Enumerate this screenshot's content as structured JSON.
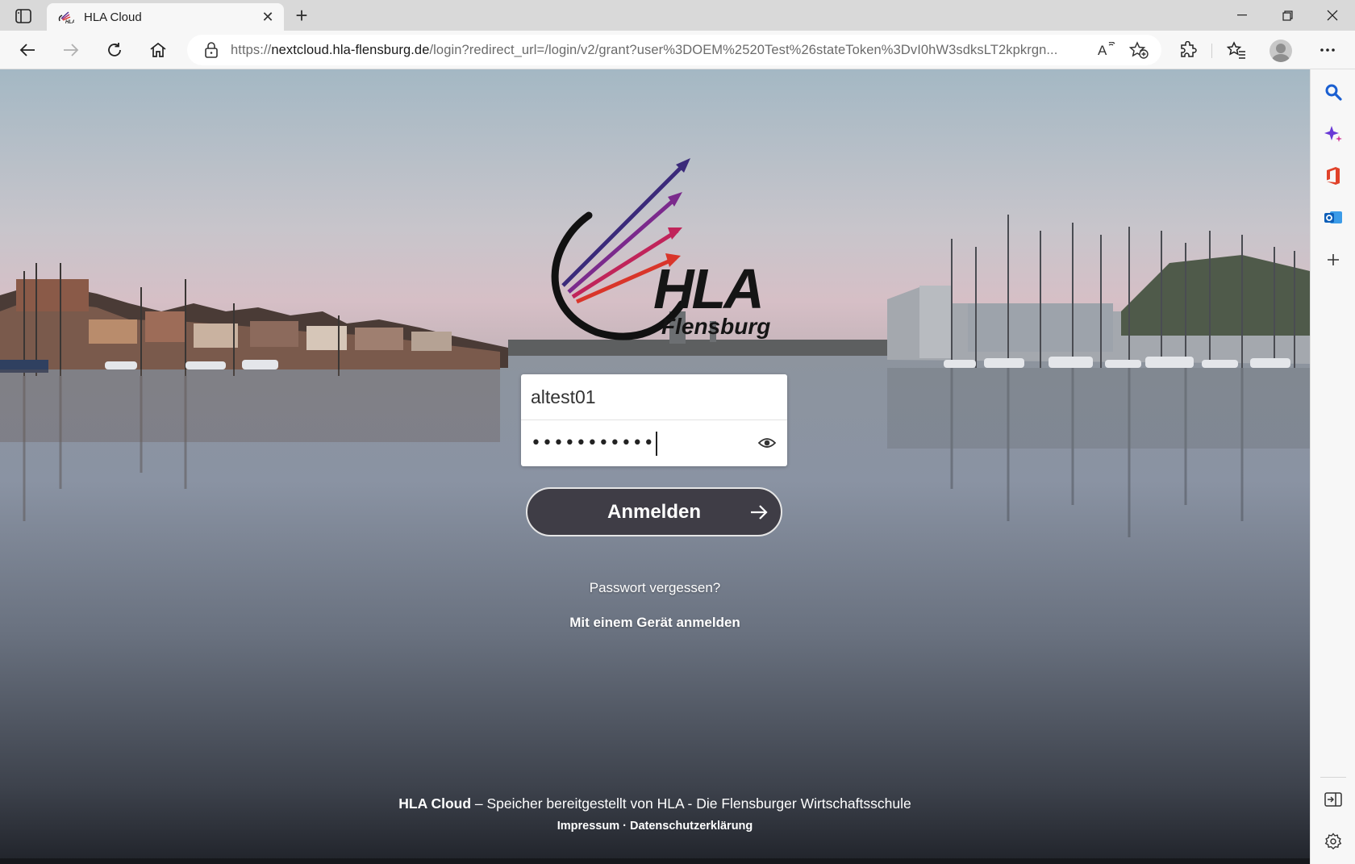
{
  "browser": {
    "tab": {
      "title": "HLA Cloud",
      "favicon": "hla-logo-icon"
    },
    "address": {
      "scheme": "https://",
      "host": "nextcloud.hla-flensburg.de",
      "path": "/login?redirect_url=/login/v2/grant?user%3DOEM%2520Test%26stateToken%3DvI0hW3sdksLT2kpkrgn..."
    },
    "icons": [
      "sidebar-toggle-icon",
      "back-icon",
      "forward-icon",
      "refresh-icon",
      "home-icon",
      "lock-icon",
      "read-aloud-icon",
      "add-favorite-icon",
      "extensions-icon",
      "favorites-icon",
      "profile-icon",
      "more-icon"
    ],
    "sidebar_icons": [
      "search-icon",
      "copilot-icon",
      "office-icon",
      "outlook-icon",
      "add-icon",
      "split-screen-icon",
      "settings-icon"
    ]
  },
  "login": {
    "username": "altest01",
    "password_mask": "•••••••••••",
    "submit_label": "Anmelden",
    "forgot_label": "Passwort vergessen?",
    "device_label": "Mit einem Gerät anmelden"
  },
  "logo": {
    "line1": "HLA",
    "line2": "Flensburg"
  },
  "footer": {
    "brand": "HLA Cloud",
    "text": " – Speicher bereitgestellt von HLA - Die Flensburger Wirtschaftsschule",
    "impressum": "Impressum",
    "separator": " · ",
    "privacy": "Datenschutzerklärung"
  },
  "colors": {
    "button": "#3f3d46",
    "arrow_1": "#3b2a7a",
    "arrow_2": "#7b2a8c",
    "arrow_3": "#c0245a",
    "arrow_4": "#d9352a"
  }
}
